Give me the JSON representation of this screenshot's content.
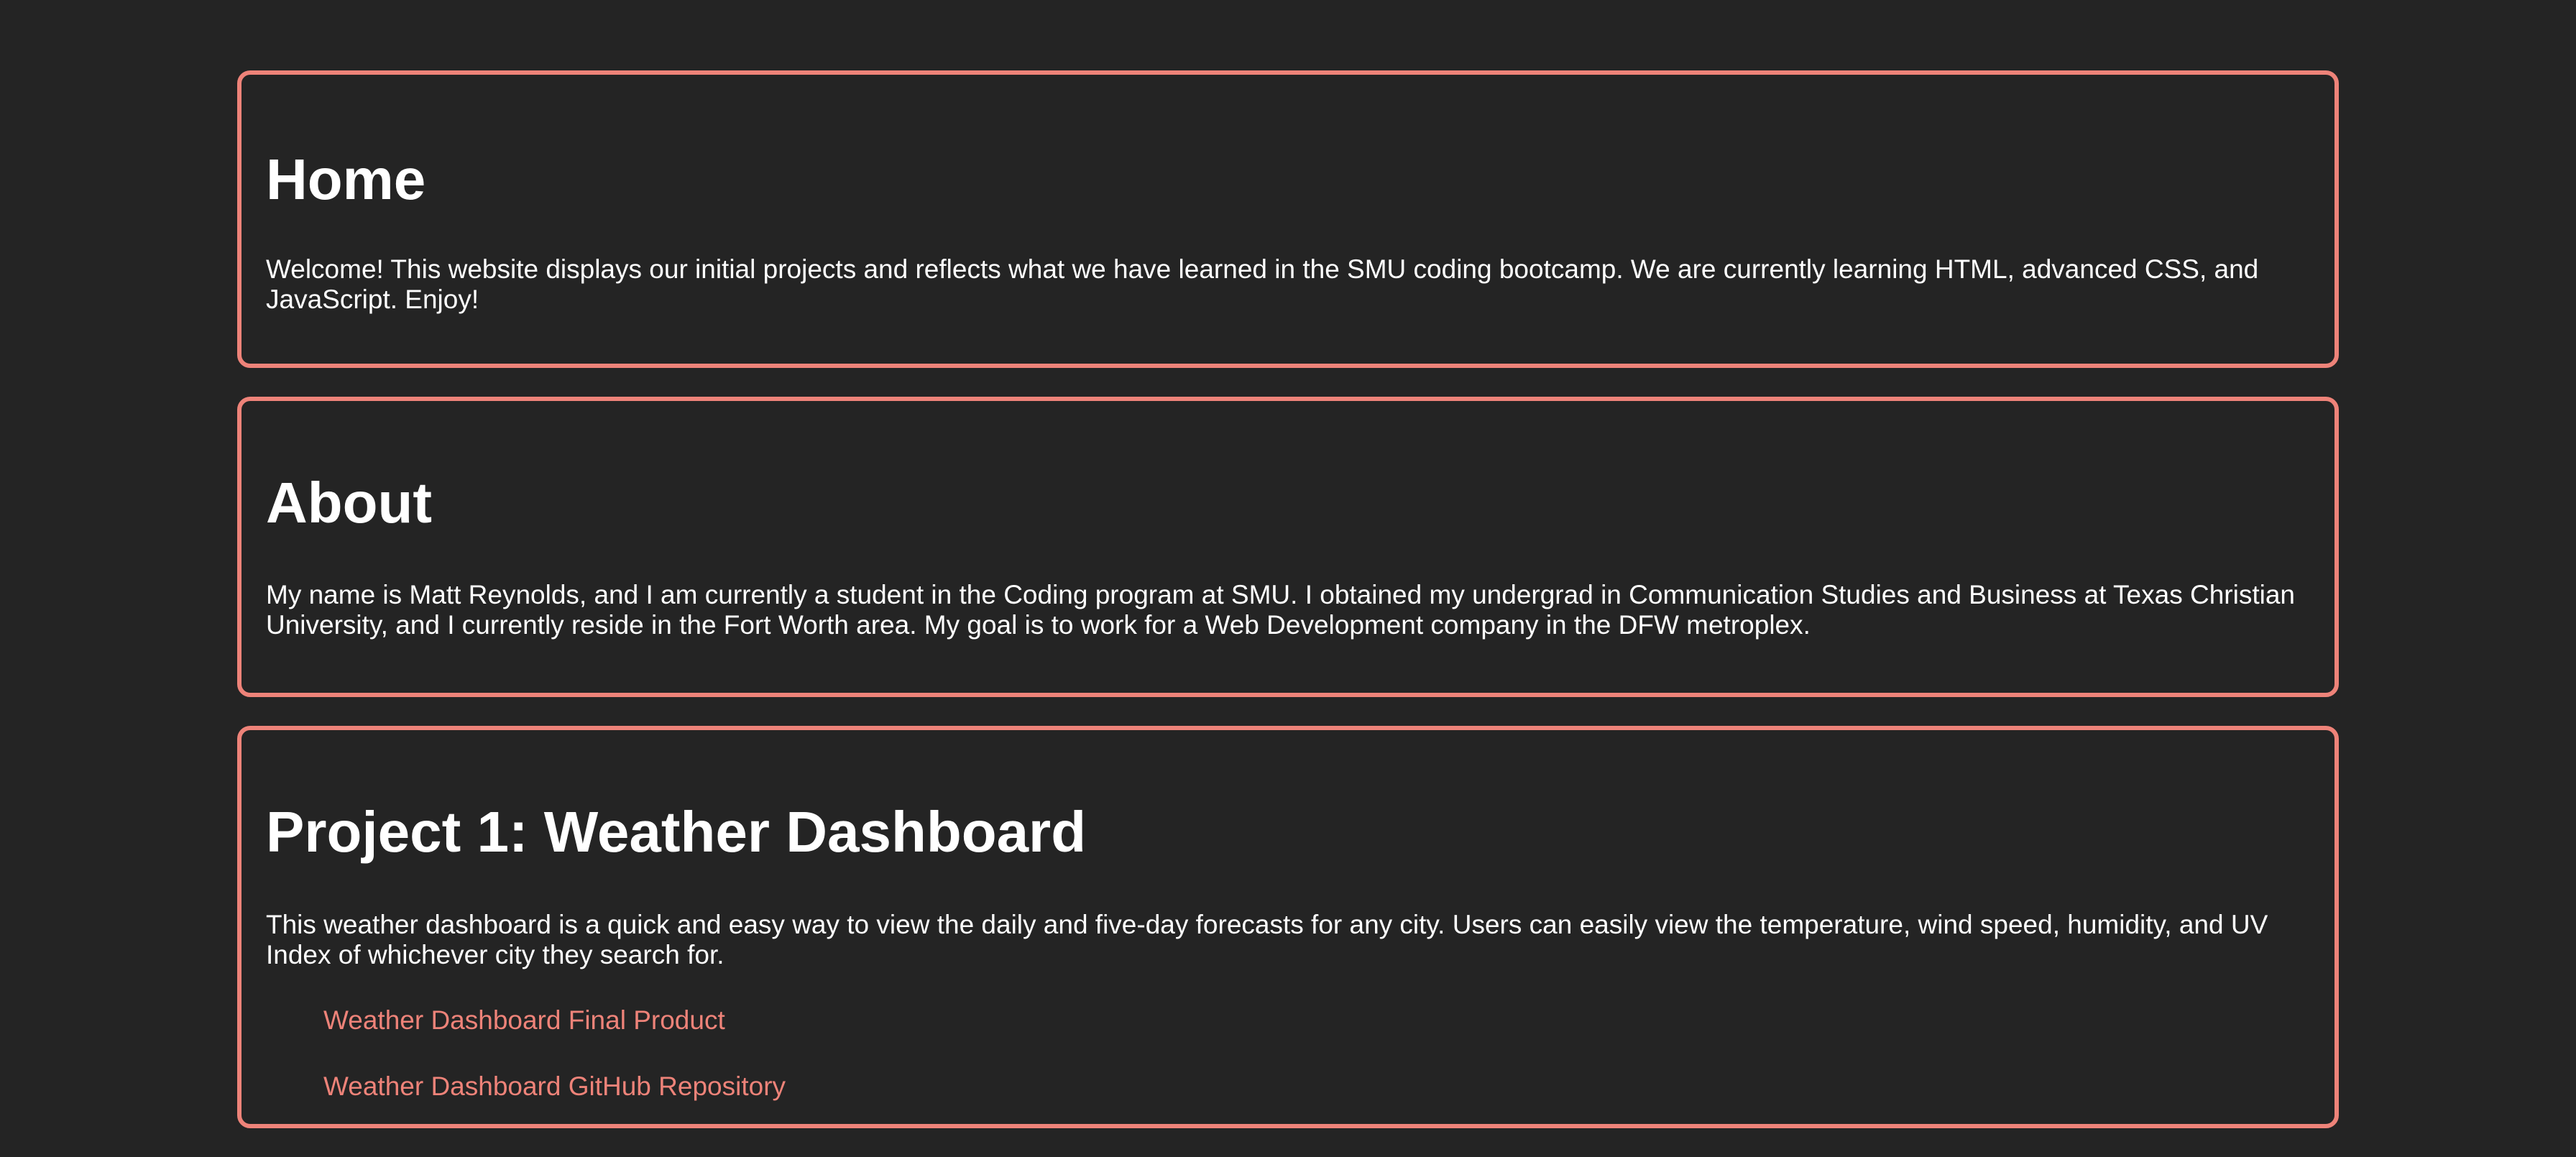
{
  "colors": {
    "background": "#242424",
    "accent": "#ee8379",
    "text": "#ffffff"
  },
  "sections": {
    "home": {
      "title": "Home",
      "body": "Welcome! This website displays our initial projects and reflects what we have learned in the SMU coding bootcamp. We are currently learning HTML, advanced CSS, and JavaScript. Enjoy!"
    },
    "about": {
      "title": "About",
      "body": "My name is Matt Reynolds, and I am currently a student in the Coding program at SMU. I obtained my undergrad in Communication Studies and Business at Texas Christian University, and I currently reside in the Fort Worth area. My goal is to work for a Web Development company in the DFW metroplex."
    },
    "project1": {
      "title": "Project 1: Weather Dashboard",
      "body": "This weather dashboard is a quick and easy way to view the daily and five-day forecasts for any city. Users can easily view the temperature, wind speed, humidity, and UV Index of whichever city they search for.",
      "links": [
        {
          "label": "Weather Dashboard Final Product"
        },
        {
          "label": "Weather Dashboard GitHub Repository"
        }
      ]
    }
  }
}
